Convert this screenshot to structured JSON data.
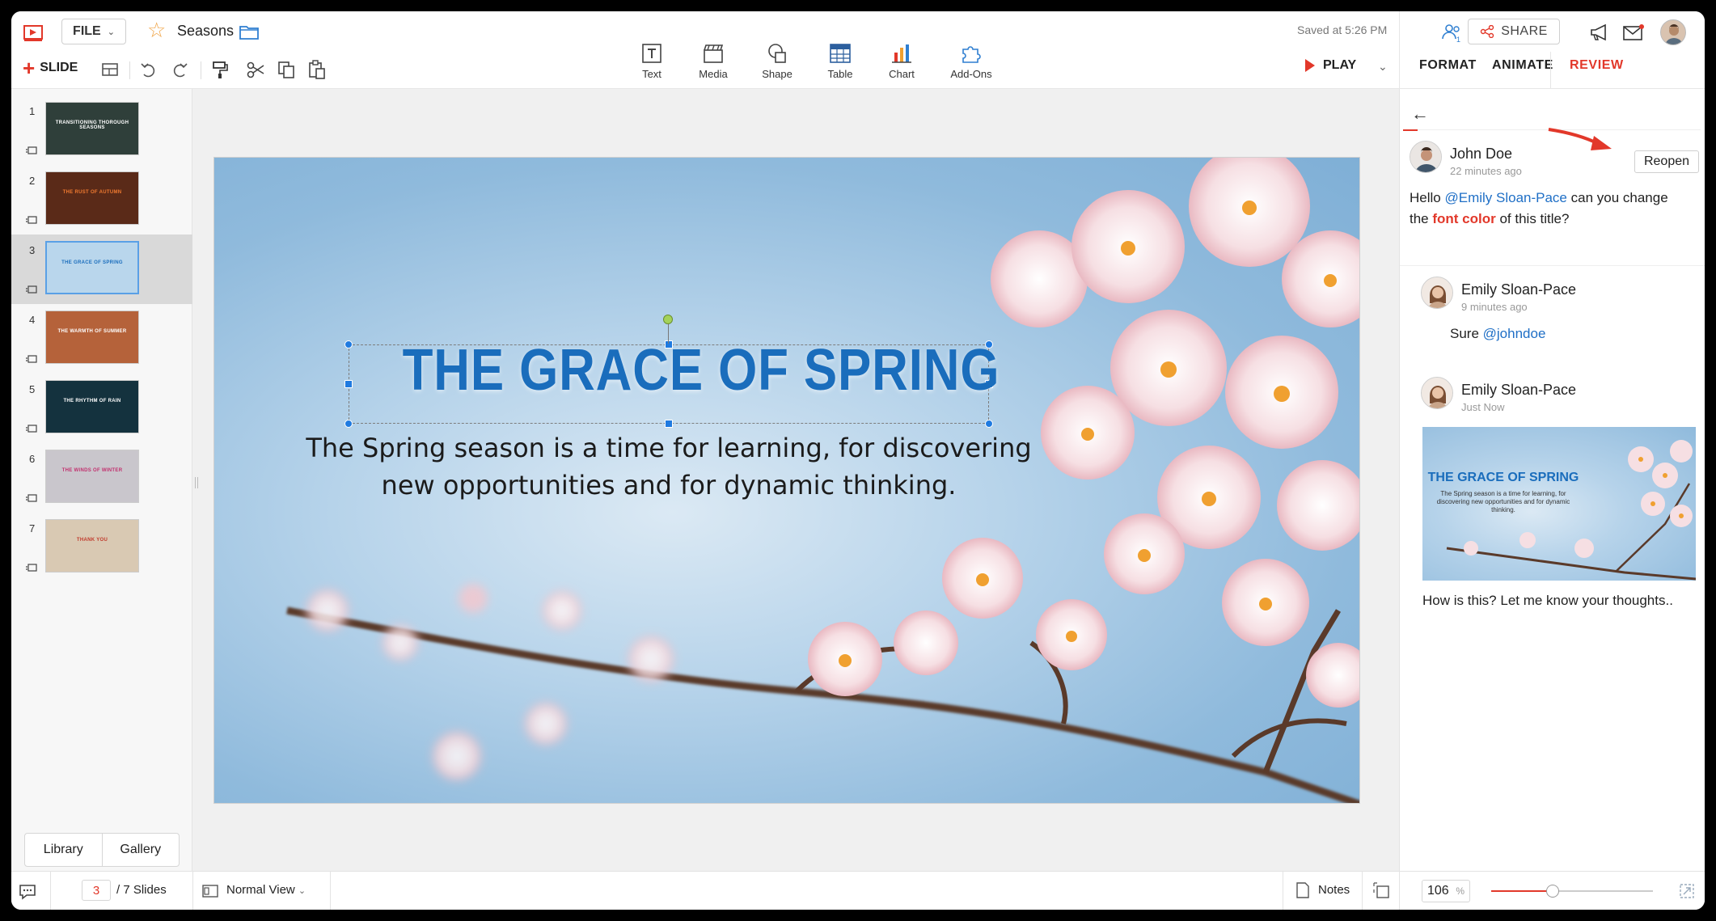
{
  "header": {
    "file_label": "FILE",
    "doc_title": "Seasons",
    "saved_status": "Saved at 5:26 PM",
    "share_label": "SHARE",
    "collab_count": "1",
    "play_label": "PLAY",
    "new_slide_label": "SLIDE"
  },
  "insert_toolbar": [
    {
      "label": "Text",
      "icon": "text-box-icon"
    },
    {
      "label": "Media",
      "icon": "media-clapper-icon"
    },
    {
      "label": "Shape",
      "icon": "shape-icon"
    },
    {
      "label": "Table",
      "icon": "table-icon"
    },
    {
      "label": "Chart",
      "icon": "bar-chart-icon"
    },
    {
      "label": "Add-Ons",
      "icon": "puzzle-icon"
    }
  ],
  "right_tabs": [
    "FORMAT",
    "ANIMATE",
    "REVIEW"
  ],
  "active_tab": "REVIEW",
  "slides": [
    {
      "num": "1",
      "title": "TRANSITIONING THOROUGH SEASONS",
      "bg": "#2f3f3a"
    },
    {
      "num": "2",
      "title": "THE RUST OF AUTUMN",
      "bg": "#5a2a18"
    },
    {
      "num": "3",
      "title": "THE GRACE OF SPRING",
      "bg": "#b9d6ec"
    },
    {
      "num": "4",
      "title": "THE WARMTH OF SUMMER",
      "bg": "#b5623a"
    },
    {
      "num": "5",
      "title": "THE RHYTHM OF RAIN",
      "bg": "#14323e"
    },
    {
      "num": "6",
      "title": "THE WINDS OF WINTER",
      "bg": "#c9c6cc"
    },
    {
      "num": "7",
      "title": "THANK YOU",
      "bg": "#d9c9b3"
    }
  ],
  "selected_slide": 3,
  "slide_content": {
    "title": "THE GRACE OF SPRING",
    "body_line1": "The Spring season is a time for learning, for discovering",
    "body_line2": "new opportunities and for dynamic thinking."
  },
  "left_panel": {
    "library": "Library",
    "gallery": "Gallery"
  },
  "review": {
    "reopen_label": "Reopen",
    "comment": {
      "author": "John Doe",
      "time": "22 minutes ago",
      "text_pre": "Hello ",
      "mention": "@Emily Sloan-Pace",
      "text_mid": " can you change",
      "text_line2_pre": "the ",
      "highlight": "font color",
      "text_post": " of this title?"
    },
    "replies": [
      {
        "author": "Emily Sloan-Pace",
        "time": "9 minutes ago",
        "text_pre": "Sure ",
        "mention": "@johndoe"
      },
      {
        "author": "Emily Sloan-Pace",
        "time": "Just Now",
        "text": "How is this? Let me know your thoughts..",
        "attachment_title": "THE GRACE OF SPRING",
        "attachment_body": "The Spring season is a time for learning, for discovering new opportunities and for dynamic thinking."
      }
    ]
  },
  "statusbar": {
    "current_page": "3",
    "total_label": "/ 7 Slides",
    "view_label": "Normal View",
    "notes_label": "Notes",
    "zoom_value": "106",
    "zoom_unit": "%",
    "zoom_fraction": 0.38
  },
  "colors": {
    "accent": "#e2382a",
    "title_blue": "#1a6dbc",
    "mention_blue": "#1f6fc6"
  }
}
